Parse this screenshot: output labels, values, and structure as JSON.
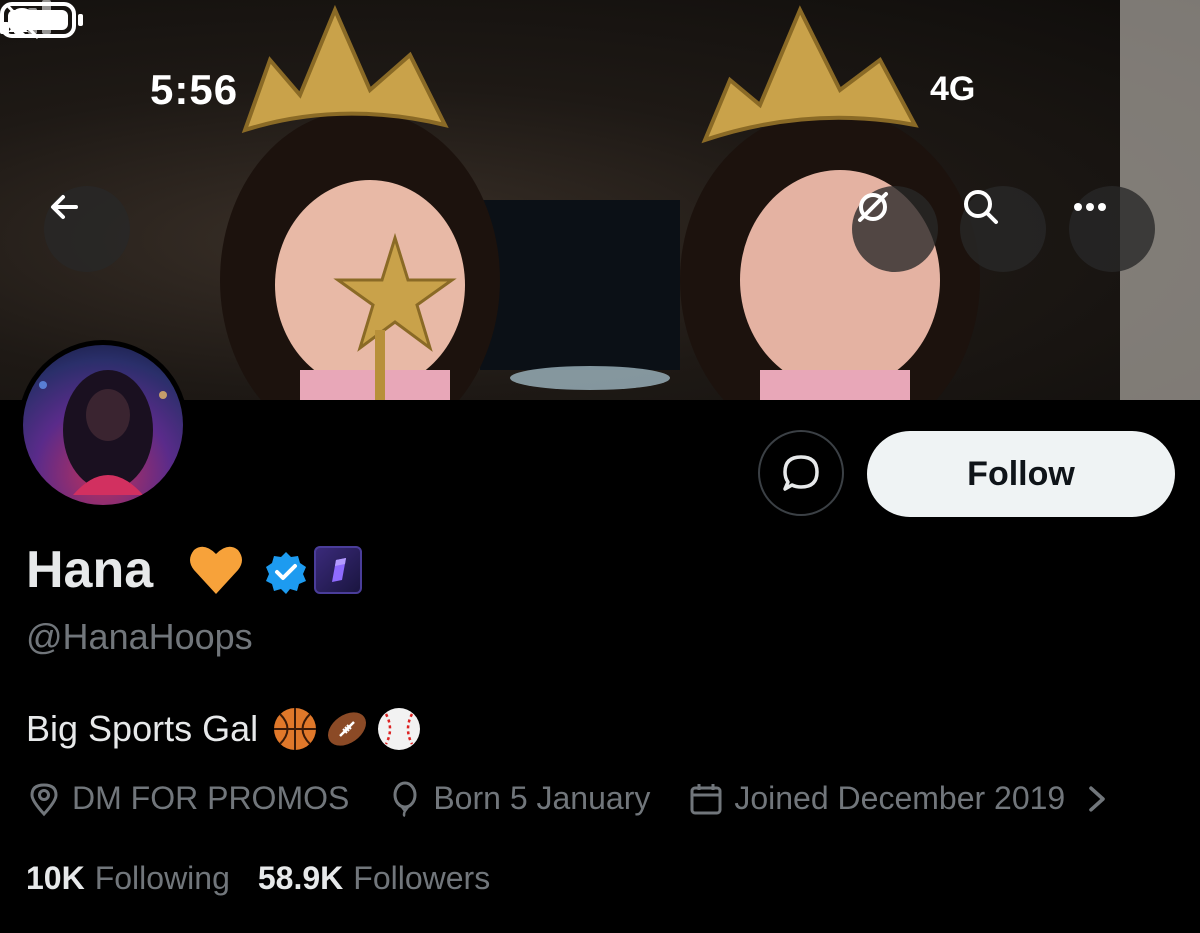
{
  "status_bar": {
    "time": "5:56",
    "network": "4G"
  },
  "header": {
    "back_icon": "arrow-left-icon",
    "grok_icon": "grok-slash-icon",
    "search_icon": "search-icon",
    "more_icon": "more-horizontal-icon"
  },
  "actions": {
    "message_icon": "message-bubble-icon",
    "follow_label": "Follow"
  },
  "profile": {
    "name": "Hana",
    "name_emoji": "orange-heart-icon",
    "verified_badge": "verified-badge-icon",
    "affiliate_badge": "affiliate-badge-icon",
    "handle": "@HanaHoops",
    "bio": "Big Sports Gal",
    "bio_emojis": [
      "basketball-icon",
      "football-icon",
      "baseball-icon"
    ],
    "location": "DM FOR PROMOS",
    "birthday": "Born 5 January",
    "joined": "Joined December 2019"
  },
  "stats": {
    "following_count": "10K",
    "following_label": "Following",
    "followers_count": "58.9K",
    "followers_label": "Followers"
  },
  "colors": {
    "background": "#000000",
    "text_primary": "#e7e9ea",
    "text_secondary": "#71767b",
    "follow_bg": "#eff3f4",
    "verified_blue": "#1d9bf0"
  }
}
